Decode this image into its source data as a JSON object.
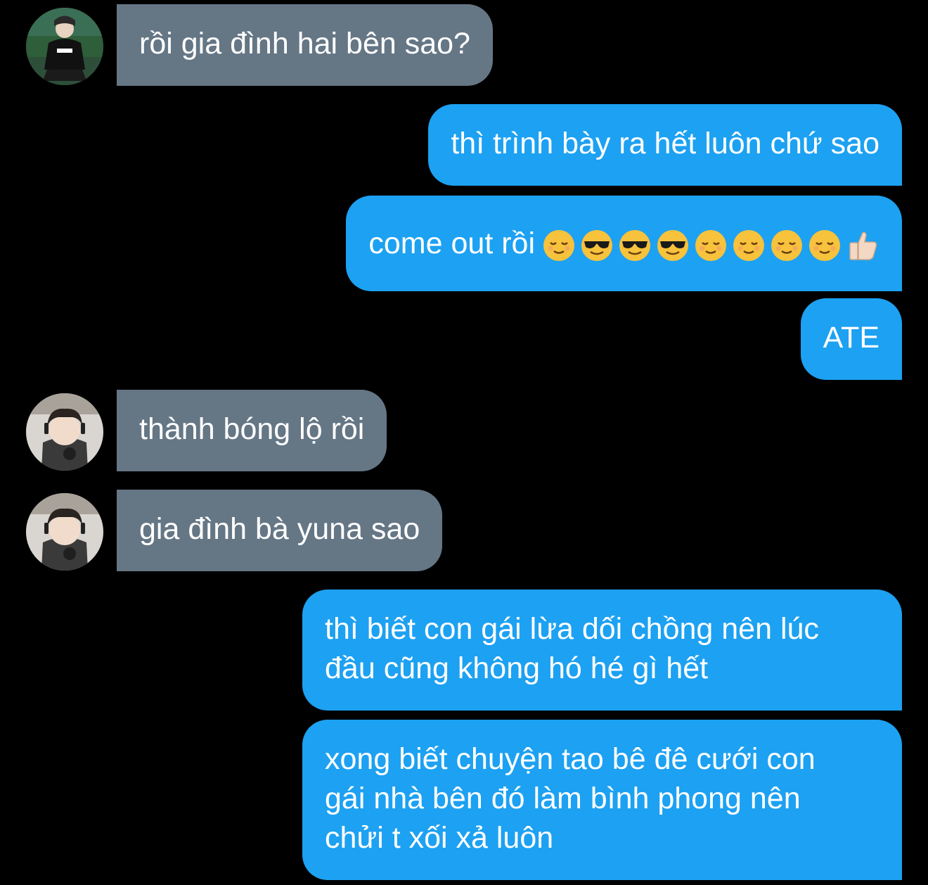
{
  "conversation": {
    "messages": [
      {
        "side": "in",
        "text": "rồi gia đình hai bên sao?",
        "avatar": "user-a"
      },
      {
        "side": "out",
        "text": "thì trình bày ra hết luôn chứ sao"
      },
      {
        "side": "out",
        "text": "come out rồi",
        "emojis": [
          "relieved-face-icon",
          "sunglasses-face-icon",
          "sunglasses-face-icon",
          "sunglasses-face-icon",
          "relieved-face-icon",
          "relieved-face-icon",
          "relieved-face-icon",
          "relieved-face-icon",
          "thumbs-up-icon"
        ]
      },
      {
        "side": "out",
        "text": "ATE"
      },
      {
        "side": "in",
        "text": "thành bóng lộ rồi",
        "avatar": "user-b"
      },
      {
        "side": "in",
        "text": "gia đình bà yuna sao",
        "avatar": "user-b"
      },
      {
        "side": "out",
        "lines": [
          "thì biết con gái lừa dối chồng nên lúc",
          "đầu cũng không hó hé gì hết"
        ]
      },
      {
        "side": "out",
        "lines": [
          "xong biết chuyện tao bê đê cưới con",
          "gái nhà bên đó làm bình phong nên",
          "chửi t xối xả luôn"
        ]
      }
    ]
  },
  "colors": {
    "background": "#000000",
    "incoming_bubble": "#657685",
    "outgoing_bubble": "#1da1f2",
    "text": "#ffffff"
  }
}
